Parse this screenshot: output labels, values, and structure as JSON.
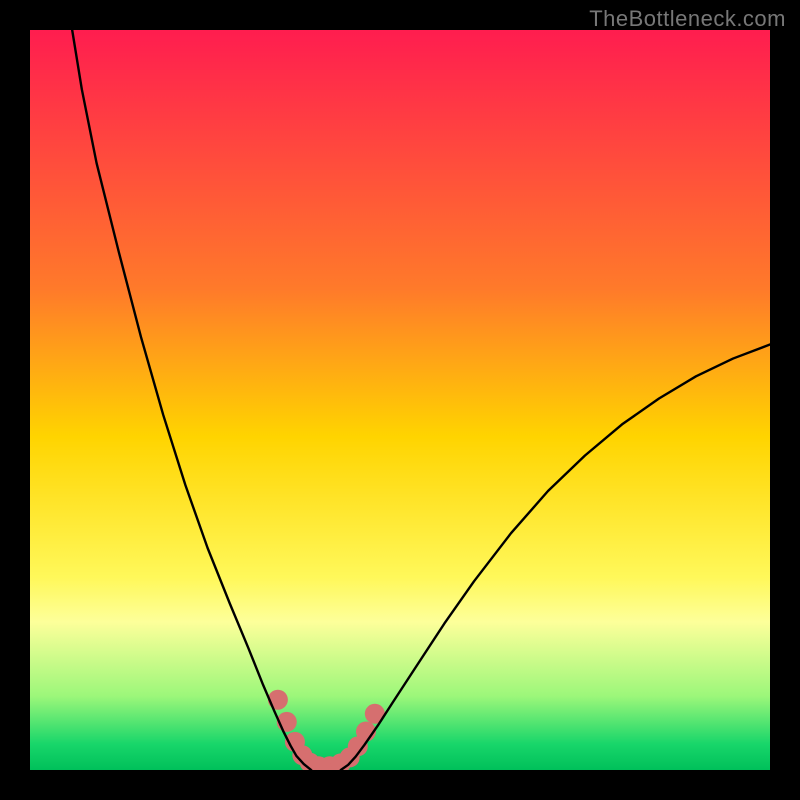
{
  "watermark": "TheBottleneck.com",
  "chart_data": {
    "type": "line",
    "title": "",
    "xlabel": "",
    "ylabel": "",
    "xlim": [
      0,
      100
    ],
    "ylim": [
      0,
      100
    ],
    "gradient_stops": [
      {
        "offset": 0,
        "color": "#ff1d4f"
      },
      {
        "offset": 35,
        "color": "#ff7a2a"
      },
      {
        "offset": 55,
        "color": "#ffd400"
      },
      {
        "offset": 74,
        "color": "#fff85a"
      },
      {
        "offset": 80,
        "color": "#fdff9a"
      },
      {
        "offset": 90,
        "color": "#9cf77a"
      },
      {
        "offset": 96.5,
        "color": "#18d66a"
      },
      {
        "offset": 100,
        "color": "#00c05a"
      }
    ],
    "series": [
      {
        "name": "left-curve",
        "values": [
          {
            "x": 5.7,
            "y": 100.0
          },
          {
            "x": 7.0,
            "y": 92.0
          },
          {
            "x": 9.0,
            "y": 82.0
          },
          {
            "x": 12.0,
            "y": 70.0
          },
          {
            "x": 15.0,
            "y": 58.5
          },
          {
            "x": 18.0,
            "y": 48.0
          },
          {
            "x": 21.0,
            "y": 38.5
          },
          {
            "x": 24.0,
            "y": 30.0
          },
          {
            "x": 27.0,
            "y": 22.5
          },
          {
            "x": 29.5,
            "y": 16.5
          },
          {
            "x": 31.5,
            "y": 11.5
          },
          {
            "x": 33.0,
            "y": 8.0
          },
          {
            "x": 34.2,
            "y": 5.3
          },
          {
            "x": 35.2,
            "y": 3.3
          },
          {
            "x": 36.0,
            "y": 1.9
          },
          {
            "x": 37.0,
            "y": 0.8
          },
          {
            "x": 38.0,
            "y": 0.0
          }
        ]
      },
      {
        "name": "right-curve",
        "values": [
          {
            "x": 42.0,
            "y": 0.0
          },
          {
            "x": 43.0,
            "y": 0.7
          },
          {
            "x": 44.0,
            "y": 1.8
          },
          {
            "x": 45.2,
            "y": 3.4
          },
          {
            "x": 47.0,
            "y": 6.0
          },
          {
            "x": 49.0,
            "y": 9.1
          },
          {
            "x": 52.0,
            "y": 13.7
          },
          {
            "x": 56.0,
            "y": 19.8
          },
          {
            "x": 60.0,
            "y": 25.5
          },
          {
            "x": 65.0,
            "y": 32.0
          },
          {
            "x": 70.0,
            "y": 37.7
          },
          {
            "x": 75.0,
            "y": 42.5
          },
          {
            "x": 80.0,
            "y": 46.7
          },
          {
            "x": 85.0,
            "y": 50.2
          },
          {
            "x": 90.0,
            "y": 53.2
          },
          {
            "x": 95.0,
            "y": 55.6
          },
          {
            "x": 100.0,
            "y": 57.5
          }
        ]
      }
    ],
    "markers": [
      {
        "x": 33.5,
        "y": 9.5
      },
      {
        "x": 34.7,
        "y": 6.5
      },
      {
        "x": 35.8,
        "y": 3.8
      },
      {
        "x": 36.8,
        "y": 2.0
      },
      {
        "x": 37.8,
        "y": 1.0
      },
      {
        "x": 39.0,
        "y": 0.5
      },
      {
        "x": 40.5,
        "y": 0.5
      },
      {
        "x": 42.0,
        "y": 0.9
      },
      {
        "x": 43.2,
        "y": 1.7
      },
      {
        "x": 44.3,
        "y": 3.2
      },
      {
        "x": 45.4,
        "y": 5.2
      },
      {
        "x": 46.6,
        "y": 7.6
      }
    ],
    "marker_color": "#d66f6f",
    "marker_radius": 10
  }
}
